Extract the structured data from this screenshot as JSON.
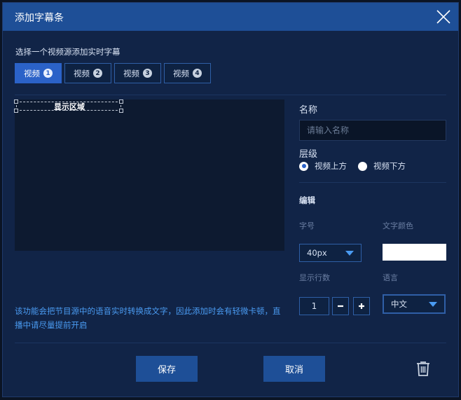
{
  "dialog": {
    "title": "添加字幕条",
    "subtitle": "选择一个视频源添加实时字幕",
    "tabs": [
      {
        "label": "视频",
        "num": "1",
        "active": true
      },
      {
        "label": "视频",
        "num": "2",
        "active": false
      },
      {
        "label": "视频",
        "num": "3",
        "active": false
      },
      {
        "label": "视频",
        "num": "4",
        "active": false
      }
    ]
  },
  "preview": {
    "region_label": "显示区域"
  },
  "notice": "该功能会把节目源中的语音实时转换成文字，因此添加时会有轻微卡顿，直播中请尽量提前开启",
  "form": {
    "name_label": "名称",
    "name_placeholder": "请输入名称",
    "layer_label": "层级",
    "layer_options": [
      "视频上方",
      "视频下方"
    ],
    "layer_selected": "视频上方",
    "edit_label": "编辑",
    "font_size_label": "字号",
    "font_size_value": "40px",
    "text_color_label": "文字颜色",
    "text_color": "#ffffff",
    "rows_label": "显示行数",
    "rows_value": "1",
    "language_label": "语言",
    "language_value": "中文"
  },
  "footer": {
    "save_label": "保存",
    "cancel_label": "取消"
  },
  "colors": {
    "titlebar": "#1e4f97",
    "dialog_bg": "#112447",
    "accent": "#2b62c8",
    "notice": "#4a9bf2"
  },
  "icons": {
    "close": "close-icon",
    "trash": "trash-icon",
    "minus": "minus-icon",
    "plus": "plus-icon",
    "caret": "chevron-down-icon"
  }
}
